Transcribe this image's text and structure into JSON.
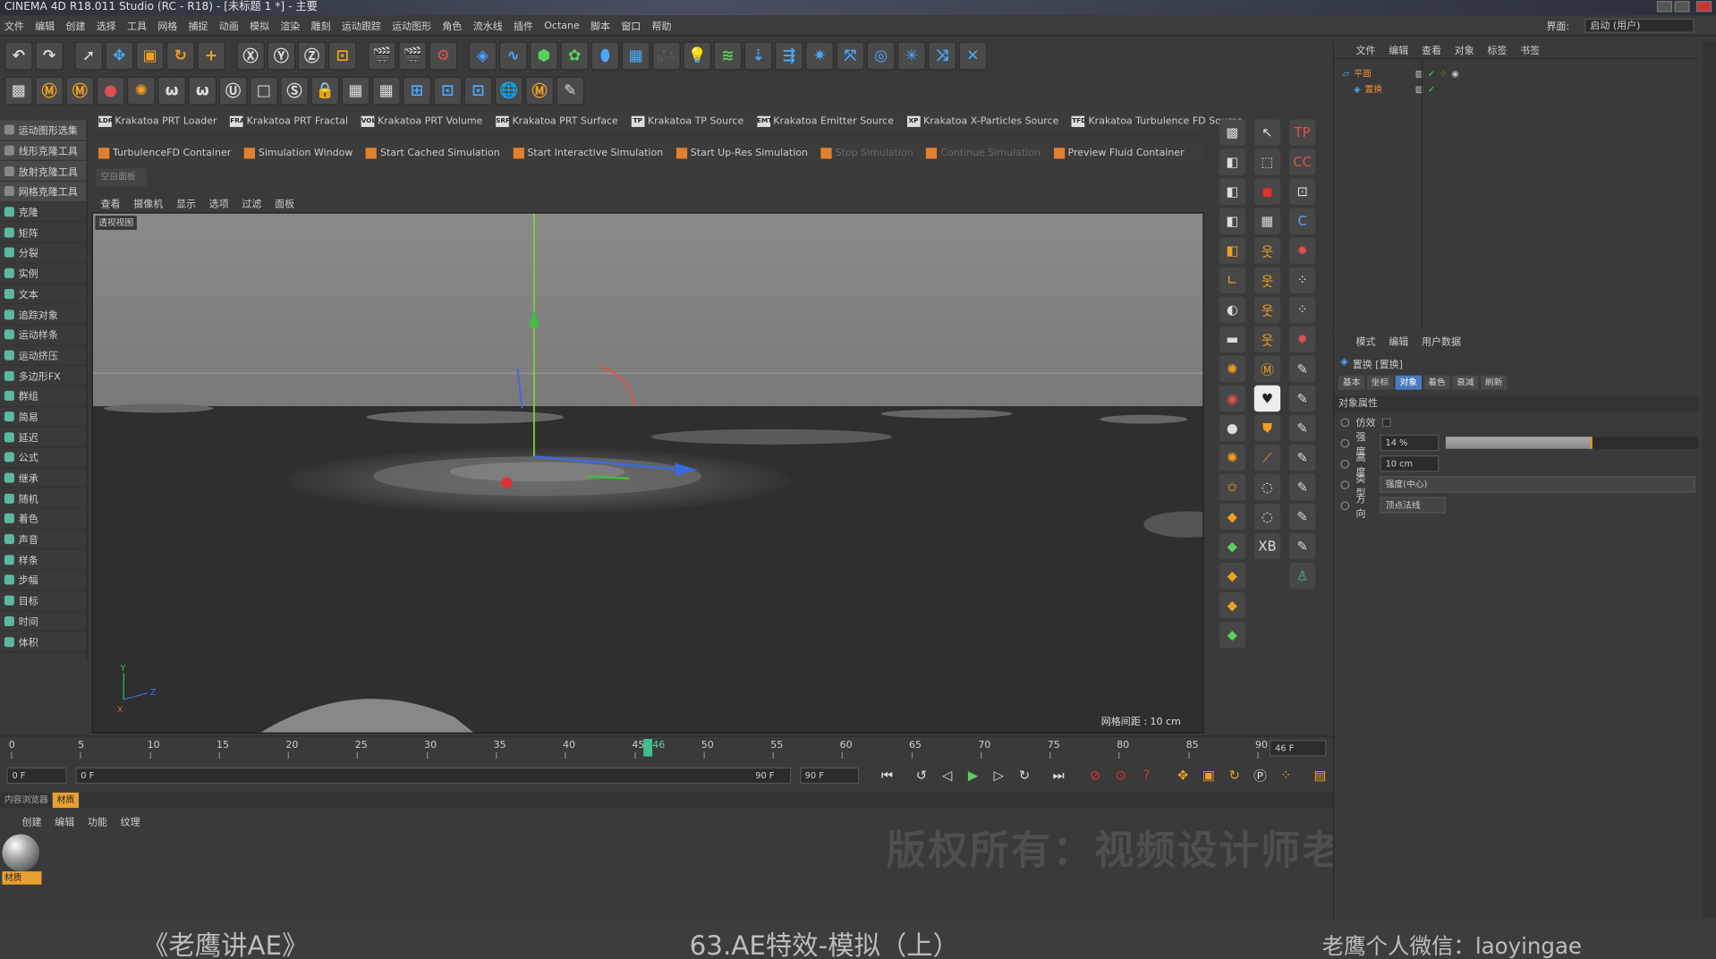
{
  "window": {
    "title": "CINEMA 4D R18.011 Studio (RC - R18) - [未标题 1 *] - 主要",
    "layout_label": "界面:",
    "layout_value": "启动 (用户)"
  },
  "menu": [
    "文件",
    "编辑",
    "创建",
    "选择",
    "工具",
    "网格",
    "捕捉",
    "动画",
    "模拟",
    "渲染",
    "雕刻",
    "运动跟踪",
    "运动图形",
    "角色",
    "流水线",
    "插件",
    "Octane",
    "脚本",
    "窗口",
    "帮助"
  ],
  "left_panel": [
    "运动图形选集",
    "线形克隆工具",
    "放射克隆工具",
    "网格克隆工具",
    "克隆",
    "矩阵",
    "分裂",
    "实例",
    "文本",
    "追踪对象",
    "运动样条",
    "运动挤压",
    "多边形FX",
    "群组",
    "简易",
    "延迟",
    "公式",
    "继承",
    "随机",
    "着色",
    "声音",
    "样条",
    "步幅",
    "目标",
    "时间",
    "体积"
  ],
  "krakatoa": [
    {
      "tag": "LDR",
      "label": "Krakatoa PRT Loader"
    },
    {
      "tag": "FRA",
      "label": "Krakatoa PRT Fractal"
    },
    {
      "tag": "VOL",
      "label": "Krakatoa PRT Volume"
    },
    {
      "tag": "SRF",
      "label": "Krakatoa PRT Surface"
    },
    {
      "tag": "TP",
      "label": "Krakatoa TP Source"
    },
    {
      "tag": "EMT",
      "label": "Krakatoa Emitter Source"
    },
    {
      "tag": "XP",
      "label": "Krakatoa X-Particles Source"
    },
    {
      "tag": "TFD",
      "label": "Krakatoa Turbulence FD Source"
    }
  ],
  "turbulence": [
    {
      "label": "TurbulenceFD Container",
      "disabled": false
    },
    {
      "label": "Simulation Window",
      "disabled": false
    },
    {
      "label": "Start Cached Simulation",
      "disabled": false
    },
    {
      "label": "Start Interactive Simulation",
      "disabled": false
    },
    {
      "label": "Start Up-Res Simulation",
      "disabled": false
    },
    {
      "label": "Stop Simulation",
      "disabled": true
    },
    {
      "label": "Continue Simulation",
      "disabled": true
    },
    {
      "label": "Preview Fluid Container",
      "disabled": false
    }
  ],
  "empty_panel": "空白面板",
  "viewport": {
    "menu": [
      "查看",
      "摄像机",
      "显示",
      "选项",
      "过滤",
      "面板"
    ],
    "label": "透视视图",
    "grid": "网格间距 : 10 cm"
  },
  "timeline": {
    "ticks": [
      0,
      5,
      10,
      15,
      20,
      25,
      30,
      35,
      40,
      45,
      50,
      55,
      60,
      65,
      70,
      75,
      80,
      85,
      90
    ],
    "current": "46",
    "frame_field": "46 F"
  },
  "transport": {
    "start": "0 F",
    "range_start": "0 F",
    "range_end": "90 F",
    "end": "90 F"
  },
  "material": {
    "tabs": [
      "内容浏览器",
      "材质"
    ],
    "menu": [
      "创建",
      "编辑",
      "功能",
      "纹理"
    ],
    "name": "材质"
  },
  "watermark": "版权所有：视频设计师老鹰",
  "footer": {
    "left": "《老鹰讲AE》",
    "center": "63.AE特效-模拟（上）",
    "right": "老鹰个人微信：laoyingae"
  },
  "objects": {
    "menu": [
      "文件",
      "编辑",
      "查看",
      "对象",
      "标签",
      "书签"
    ],
    "items": [
      {
        "name": "平面"
      },
      {
        "name": "置换"
      }
    ]
  },
  "attributes": {
    "menu": [
      "模式",
      "编辑",
      "用户数据"
    ],
    "title": "置换 [置换]",
    "tabs": [
      "基本",
      "坐标",
      "对象",
      "着色",
      "衰减",
      "刷新"
    ],
    "active_tab": "对象",
    "section": "对象属性",
    "props": {
      "imitate": {
        "label": "仿效"
      },
      "strength": {
        "label": "强度",
        "value": "14 %",
        "fill": 0.14
      },
      "height": {
        "label": "高度",
        "value": "10 cm"
      },
      "type": {
        "label": "类型",
        "value": "强度(中心)"
      },
      "direction": {
        "label": "方向",
        "value": "顶点法线"
      }
    }
  }
}
